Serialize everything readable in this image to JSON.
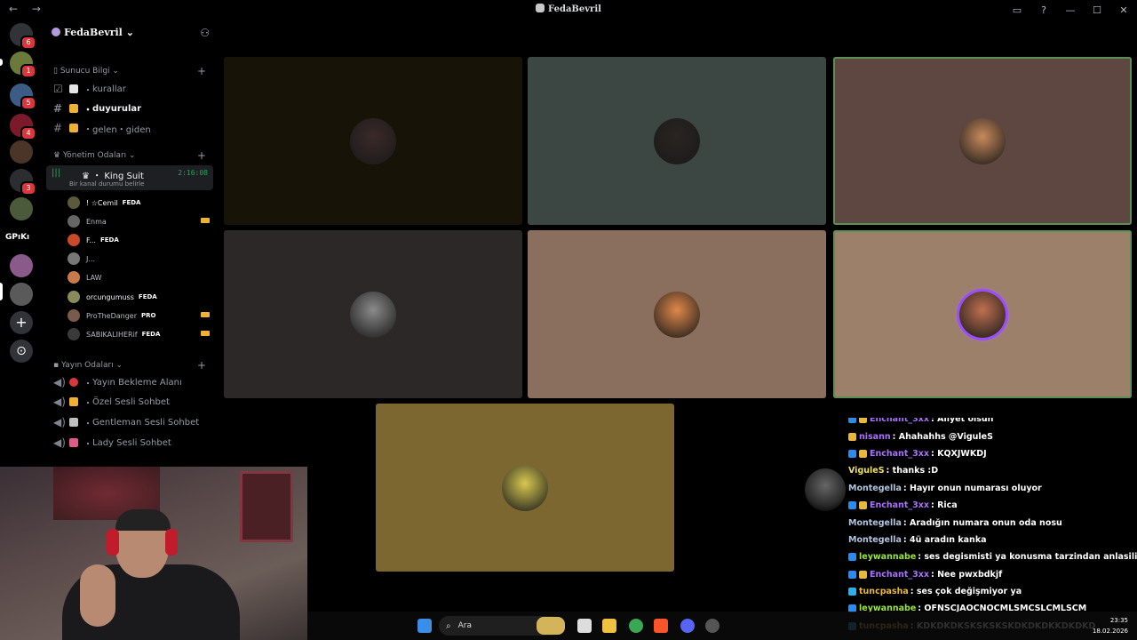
{
  "window": {
    "title": "FedaBevril",
    "nav": "← →",
    "controls": [
      "▭",
      "?",
      "—",
      "☐",
      "✕"
    ]
  },
  "rail": {
    "servers": [
      {
        "icon": "discord-home-icon",
        "color": "#313338",
        "badge": "6"
      },
      {
        "icon": "server-avatar-icon",
        "color": "#6b7a3a",
        "badge": "1"
      },
      {
        "icon": "server-avatar-icon",
        "color": "#3d5c85",
        "badge": "5"
      },
      {
        "icon": "server-avatar-icon",
        "color": "#7a1a2a",
        "badge": "4"
      },
      {
        "icon": "server-avatar-icon",
        "color": "#4a3528",
        "badge": ""
      },
      {
        "icon": "server-avatar-icon",
        "color": "#2b2d31",
        "badge": "3"
      },
      {
        "icon": "server-avatar-icon",
        "color": "#4b5a3a",
        "badge": ""
      },
      {
        "icon": "server-avatar-icon",
        "color": "#8a5a8a",
        "badge": ""
      },
      {
        "icon": "server-avatar-icon",
        "color": "#5a5a5a",
        "badge": ""
      }
    ],
    "gpiki_label": "GPıKı",
    "add_label": "+",
    "explore_label": "⊙"
  },
  "sidebar": {
    "guild_name": "FedaBevril",
    "categories": [
      {
        "label": "Sunucu Bilgi"
      },
      {
        "label": "Yönetim Odaları"
      },
      {
        "label": "Yayın Odaları"
      }
    ],
    "info_channels": [
      {
        "label": "kurallar",
        "emoji_color": "#e6e6e6"
      },
      {
        "label": "duyurular",
        "emoji_color": "#f0b232"
      },
      {
        "label": "gelen・giden",
        "emoji_color": "#f0b232"
      }
    ],
    "active_voice": {
      "name": "King Suit",
      "time": "2:16:08",
      "status": "Bir kanal durumu belirle"
    },
    "voice_users": [
      {
        "name": "! ☆Cemil",
        "tag": "FEDA",
        "color": "#5a5a3a",
        "live": false,
        "white": true
      },
      {
        "name": "Enma",
        "tag": "",
        "color": "#666",
        "live": true,
        "white": false
      },
      {
        "name": "F...",
        "tag": "FEDA",
        "color": "#c84a2a",
        "live": false,
        "white": true
      },
      {
        "name": "J...",
        "tag": "",
        "color": "#777",
        "live": false,
        "white": false
      },
      {
        "name": "LAW",
        "tag": "",
        "color": "#c87a4a",
        "live": false,
        "white": false
      },
      {
        "name": "orcungumuss",
        "tag": "FEDA",
        "color": "#8a8a5a",
        "live": false,
        "white": true
      },
      {
        "name": "ProTheDanger",
        "tag": "PRO",
        "color": "#7a5a4a",
        "live": true,
        "white": false
      },
      {
        "name": "SABIKALIHERif",
        "tag": "FEDA",
        "color": "#3a3a3a",
        "live": true,
        "white": false
      }
    ],
    "stream_channels": [
      {
        "label": "Yayın Bekleme Alanı",
        "emoji_color": "#da373c"
      },
      {
        "label": "Özel Sesli Sohbet",
        "emoji_color": "#f0b232"
      },
      {
        "label": "Gentleman Sesli Sohbet",
        "emoji_color": "#c0c0c0"
      },
      {
        "label": "Lady Sesli Sohbet",
        "emoji_color": "#e05a8a"
      }
    ]
  },
  "tiles": [
    {
      "bg": "#171407",
      "av": "#3a2a28",
      "speaking": false
    },
    {
      "bg": "#3c4744",
      "av": "#2a2420",
      "speaking": false
    },
    {
      "bg": "#5e4740",
      "av": "#c88a5a",
      "speaking": true
    },
    {
      "bg": "#2c2828",
      "av": "#8a8a8a",
      "speaking": false
    },
    {
      "bg": "#8a6e5e",
      "av": "#e0884a",
      "speaking": false
    },
    {
      "bg": "#9c806a",
      "av": "#c07050",
      "speaking": true
    },
    {
      "bg": "#7c6730",
      "av": "#d8c850",
      "speaking": false
    }
  ],
  "chat": {
    "messages": [
      {
        "user": "Enchant_3xx",
        "text": " : Allyet olsun",
        "color": "#a970ff",
        "badges": [
          "#2a8cf0",
          "#e9b83a"
        ],
        "cut": true
      },
      {
        "user": "nisann",
        "text": " : Ahahahhs @VigulеS",
        "color": "#a970ff",
        "badges": [
          "#e9b83a"
        ],
        "cut": false
      },
      {
        "user": "Enchant_3xx",
        "text": " : KQXJWKDJ",
        "color": "#a970ff",
        "badges": [
          "#2a8cf0",
          "#e9b83a"
        ],
        "cut": false
      },
      {
        "user": "VigulеS",
        "text": " : thanks :D",
        "color": "#f0e060",
        "badges": [],
        "cut": false
      },
      {
        "user": "Montegella",
        "text": " : Hayır onun numarası oluyor",
        "color": "#b0c4de",
        "badges": [],
        "cut": false
      },
      {
        "user": "Enchant_3xx",
        "text": " : Rica",
        "color": "#a970ff",
        "badges": [
          "#2a8cf0",
          "#e9b83a"
        ],
        "cut": false
      },
      {
        "user": "Montegella",
        "text": " : Aradığın numara onun oda nosu",
        "color": "#b0c4de",
        "badges": [],
        "cut": false
      },
      {
        "user": "Montegella",
        "text": " : 4ü aradın kanka",
        "color": "#b0c4de",
        "badges": [],
        "cut": false
      },
      {
        "user": "leywannabe",
        "text": " : ses degismisti ya konusma tarzindan anlasilio",
        "color": "#9ae63a",
        "badges": [
          "#2a8cf0"
        ],
        "cut": false
      },
      {
        "user": "Enchant_3xx",
        "text": " : Nee pwxbdkjf",
        "color": "#a970ff",
        "badges": [
          "#2a8cf0",
          "#e9b83a"
        ],
        "cut": false
      },
      {
        "user": "tuncpasha",
        "text": " : ses çok değişmiyor ya",
        "color": "#e9b83a",
        "badges": [
          "#2ab0f0"
        ],
        "cut": false
      },
      {
        "user": "leywannabe",
        "text": " : OFNSCJAOCNOCMLSMCSLCMLSCM",
        "color": "#9ae63a",
        "badges": [
          "#2a8cf0"
        ],
        "cut": false
      },
      {
        "user": "tuncpasha",
        "text": " : KDKDKDKSKSKSKSKDKDKDKKDKDKD",
        "color": "#e9b83a",
        "badges": [
          "#2ab0f0"
        ],
        "cut": false
      }
    ]
  },
  "taskbar": {
    "search_label": "Ara",
    "time": "23:35",
    "date": "18.02.2026"
  }
}
